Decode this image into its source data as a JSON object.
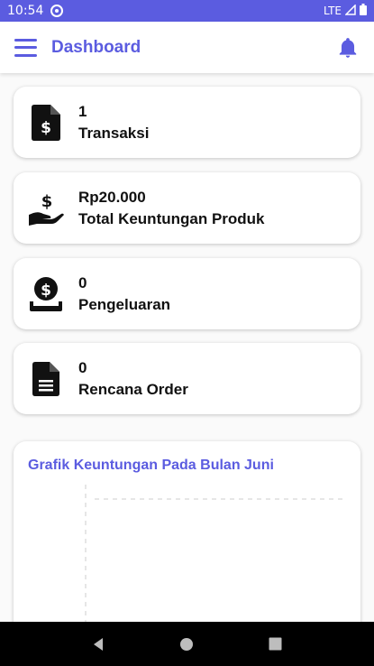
{
  "status_bar": {
    "time": "10:54",
    "network": "LTE"
  },
  "app_bar": {
    "title": "Dashboard",
    "menu_icon": "hamburger-menu-icon",
    "bell_icon": "bell-icon"
  },
  "cards": [
    {
      "value": "1",
      "label": "Transaksi",
      "icon": "invoice-dollar-icon"
    },
    {
      "value": "Rp20.000",
      "label": "Total Keuntungan Produk",
      "icon": "hand-dollar-icon"
    },
    {
      "value": "0",
      "label": "Pengeluaran",
      "icon": "money-tray-icon"
    },
    {
      "value": "0",
      "label": "Rencana Order",
      "icon": "document-icon"
    }
  ],
  "chart_data": {
    "type": "line",
    "title": "Grafik Keuntungan Pada Bulan Juni",
    "series": [],
    "grid": true
  },
  "colors": {
    "accent": "#5b5ce0",
    "card_bg": "#ffffff",
    "page_bg": "#fafafa"
  }
}
